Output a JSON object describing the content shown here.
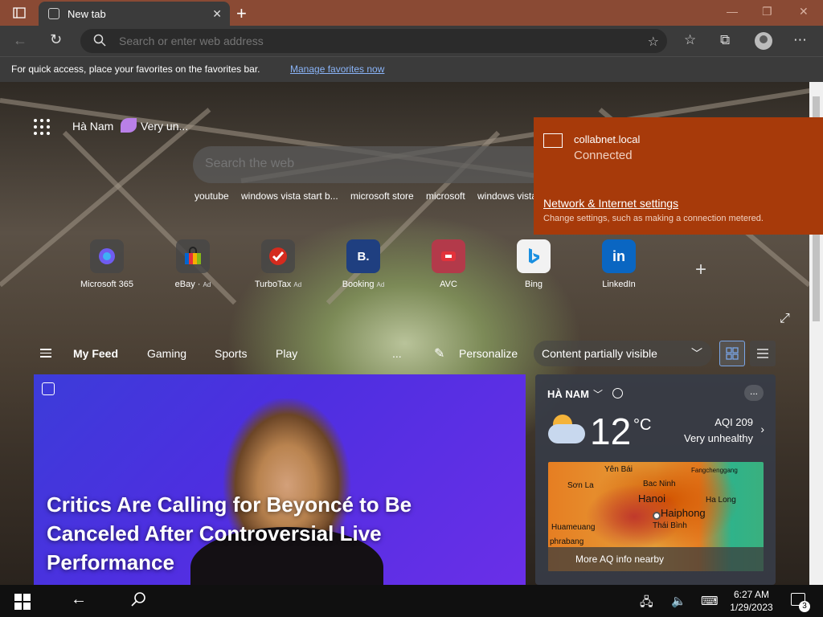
{
  "browser": {
    "tab_title": "New tab",
    "address_placeholder": "Search or enter web address"
  },
  "favbar": {
    "text": "For quick access, place your favorites on the favorites bar.",
    "link": "Manage favorites now"
  },
  "newtab": {
    "location": "Hà Nam",
    "weather_short": "Very un...",
    "search_placeholder": "Search the web",
    "quicklinks": [
      "youtube",
      "windows vista start b...",
      "microsoft store",
      "microsoft",
      "windows vista"
    ],
    "tiles": [
      {
        "label": "Microsoft 365",
        "ad": ""
      },
      {
        "label": "eBay",
        "ad": "Ad"
      },
      {
        "label": "TurboTax",
        "ad": "Ad"
      },
      {
        "label": "Booking",
        "ad": "Ad"
      },
      {
        "label": "AVC",
        "ad": ""
      },
      {
        "label": "Bing",
        "ad": ""
      },
      {
        "label": "LinkedIn",
        "ad": ""
      }
    ],
    "tile_letters": [
      "",
      "",
      "",
      "B.",
      "",
      "",
      "in"
    ],
    "feed_nav": [
      "My Feed",
      "Gaming",
      "Sports",
      "Play",
      "..."
    ],
    "personalize": "Personalize",
    "content_visibility": "Content partially visible"
  },
  "hero": {
    "title": "Critics Are Calling for Beyoncé to Be Canceled After Controversial Live Performance"
  },
  "weather": {
    "city": "HÀ NAM",
    "temp": "12",
    "unit": "°C",
    "aqi": "AQI 209",
    "aqi_status": "Very unhealthy",
    "more_aq": "More AQ info nearby",
    "more_btn": "...",
    "map_labels": [
      "Yên Bái",
      "Fangchenggang",
      "Sơn La",
      "Bac Ninh",
      "Hanoi",
      "Ha Long",
      "Haiphong",
      "Huameuang",
      "Thái Bình",
      "phrabang"
    ]
  },
  "network": {
    "name": "collabnet.local",
    "status": "Connected",
    "settings_link": "Network & Internet settings",
    "settings_desc": "Change settings, such as making a connection metered."
  },
  "taskbar": {
    "time": "6:27 AM",
    "date": "1/29/2023",
    "notification_count": "3"
  },
  "colors": {
    "titlebar": "#8a4a34",
    "flyout": "#a73a0a",
    "accent_link": "#8ab4f8"
  }
}
